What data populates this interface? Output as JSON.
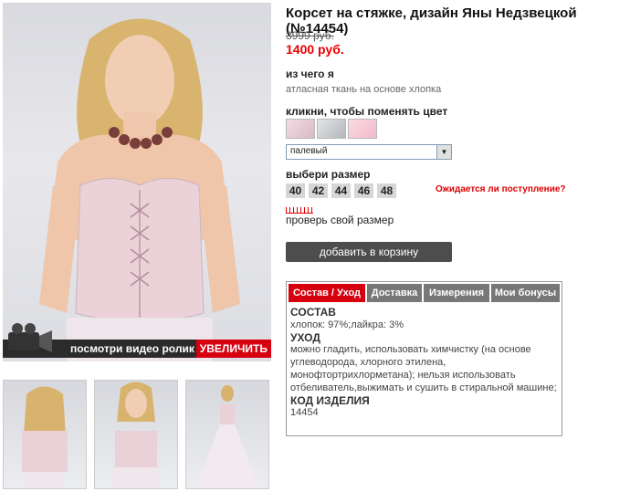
{
  "product": {
    "title": "Корсет на стяжке, дизайн Яны Недзвецкой (№14454)",
    "old_price": "3999 руб.",
    "new_price": "1400 руб."
  },
  "material": {
    "label": "из чего я",
    "value": "атласная ткань на основе хлопка"
  },
  "color": {
    "label": "кликни, чтобы поменять цвет",
    "swatches": [
      "#e9cfd6",
      "#c8c9cd",
      "#f6c9d6"
    ],
    "selected": "палевый"
  },
  "size": {
    "label": "выбери размер",
    "options": [
      "40",
      "42",
      "44",
      "46",
      "48"
    ],
    "await_link": "Ожидается ли поступление?",
    "check_link": "проверь свой размер"
  },
  "cart_button": "добавить в корзину",
  "media": {
    "video_label": "посмотри видео ролик",
    "enlarge_label": "УВЕЛИЧИТЬ"
  },
  "tabs": [
    "Состав / Уход",
    "Доставка",
    "Измерения",
    "Мои бонусы"
  ],
  "info": {
    "composition_heading": "СОСТАВ",
    "composition": "хлопок: 97%;лайкра: 3%",
    "care_heading": "УХОД",
    "care": "можно гладить, использовать химчистку (на основе углеводорода, хлорного этилена, монофтортрихлорметана); нельзя использовать отбеливатель,выжимать и сушить в стиральной машине;",
    "code_heading": "КОД ИЗДЕЛИЯ",
    "code": "14454"
  },
  "colors": {
    "accent": "#d6000f",
    "price": "#ee0000",
    "button": "#4d4d4d",
    "tab_inactive": "#777777"
  }
}
